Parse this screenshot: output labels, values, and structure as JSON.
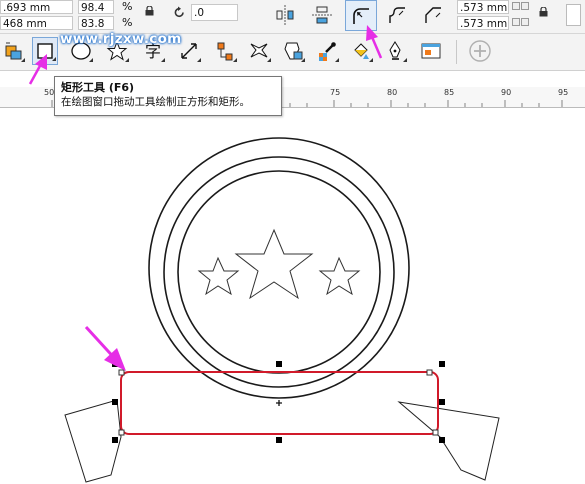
{
  "property_bar": {
    "width_value": ".693 mm",
    "height_value": "468 mm",
    "scale_x": "98.4",
    "scale_y": "83.8",
    "percent_symbol": "%",
    "rotation_value": ".0",
    "outline_top": ".573 mm",
    "outline_bottom": ".573 mm"
  },
  "watermark": "www.rjzxw.com",
  "tooltip": {
    "title": "矩形工具 (F6)",
    "description": "在绘图窗口拖动工具绘制正方形和矩形。"
  },
  "ruler": {
    "ticks": [
      "50",
      "75",
      "80",
      "85",
      "90",
      "95"
    ]
  },
  "colors": {
    "selection": "#d11a2a",
    "annotation_arrow": "#e62ee6",
    "outline": "#1a1a1a",
    "watermark_glow": "#2a7bd6"
  },
  "toolbox": [
    "smart-fill-icon",
    "rectangle-tool-icon",
    "ellipse-tool-icon",
    "star-tool-icon",
    "text-tool-icon",
    "dimension-tool-icon",
    "connector-tool-icon",
    "blend-tool-icon",
    "distort-tool-icon",
    "transparency-tool-icon",
    "eyedropper-tool-icon",
    "interactive-fill-icon",
    "pen-tool-icon",
    "window-tool-icon",
    "add-tool-icon"
  ]
}
